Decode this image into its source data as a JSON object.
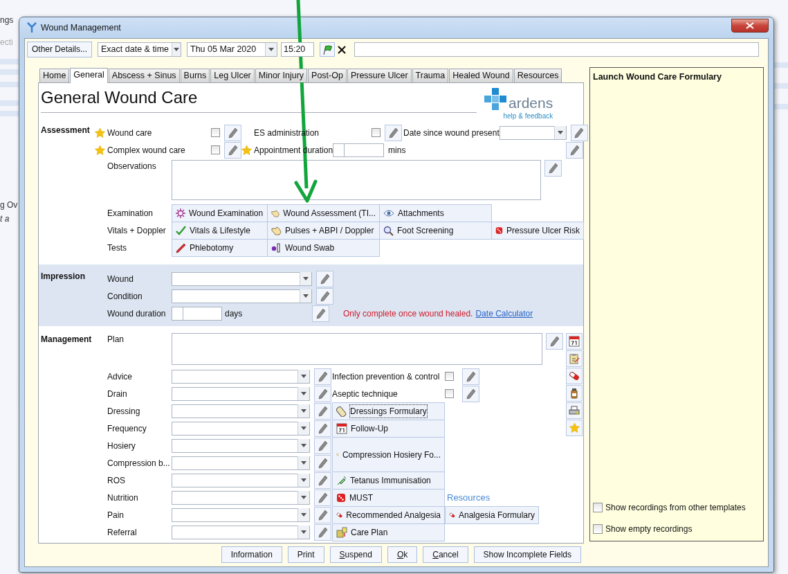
{
  "background": {
    "fragments": [
      "ngs",
      "ecti",
      "g Ov",
      "t a"
    ]
  },
  "window": {
    "title": "Wound Management"
  },
  "toolbar": {
    "details_button": "Other Details...",
    "date_mode": "Exact date & time",
    "date": "Thu 05 Mar 2020",
    "time": "15:20"
  },
  "tabs": [
    {
      "label": "Home",
      "selected": false
    },
    {
      "label": "General",
      "selected": true
    },
    {
      "label": "Abscess + Sinus",
      "selected": false
    },
    {
      "label": "Burns",
      "selected": false
    },
    {
      "label": "Leg Ulcer",
      "selected": false
    },
    {
      "label": "Minor Injury",
      "selected": false
    },
    {
      "label": "Post-Op",
      "selected": false
    },
    {
      "label": "Pressure Ulcer",
      "selected": false
    },
    {
      "label": "Trauma",
      "selected": false
    },
    {
      "label": "Healed Wound",
      "selected": false
    },
    {
      "label": "Resources",
      "selected": false
    }
  ],
  "form": {
    "title": "General Wound Care",
    "logo": "ardens",
    "logo_link": "help & feedback"
  },
  "assessment": {
    "heading": "Assessment",
    "fields": [
      {
        "kind": "checkbox",
        "label": "Wound care",
        "starred": true,
        "checked": false
      },
      {
        "kind": "checkbox",
        "label": "ES administration",
        "starred": false,
        "checked": false
      },
      {
        "kind": "dropdown",
        "label": "Date since wound present",
        "starred": false
      },
      {
        "kind": "checkbox",
        "label": "Complex wound care",
        "starred": true,
        "checked": false
      },
      {
        "kind": "number",
        "label": "Appointment duration",
        "starred": true,
        "unit": "mins"
      },
      {
        "kind": "pencil"
      }
    ],
    "observations": {
      "label": "Observations"
    },
    "link_groups": [
      {
        "label": "Examination",
        "links": [
          "Wound Examination",
          "Wound Assessment (TI...",
          "Attachments"
        ]
      },
      {
        "label": "Vitals + Doppler",
        "links": [
          "Vitals & Lifestyle",
          "Pulses + ABPI / Doppler",
          "Foot Screening",
          "Pressure Ulcer Risk"
        ]
      },
      {
        "label": "Tests",
        "links": [
          "Phlebotomy",
          "Wound Swab"
        ]
      }
    ]
  },
  "impression": {
    "heading": "Impression",
    "rows": [
      {
        "kind": "dropdown",
        "label": "Wound"
      },
      {
        "kind": "dropdown",
        "label": "Condition"
      },
      {
        "kind": "number",
        "label": "Wound duration",
        "unit": "days",
        "note": "Only complete once wound healed.",
        "link": "Date Calculator"
      }
    ]
  },
  "management": {
    "heading": "Management",
    "plan": {
      "label": "Plan"
    },
    "rows": [
      {
        "label": "Advice",
        "side": {
          "kind": "checkbox",
          "label": "Infection prevention & control",
          "checked": false
        }
      },
      {
        "label": "Drain",
        "side": {
          "kind": "checkbox",
          "label": "Aseptic technique",
          "checked": false
        }
      },
      {
        "label": "Dressing",
        "side": {
          "kind": "link",
          "label": "Dressings Formulary",
          "focused": true
        }
      },
      {
        "label": "Frequency",
        "side": {
          "kind": "link",
          "label": "Follow-Up",
          "focused": false
        }
      },
      {
        "label": "Hosiery",
        "side": {
          "kind": "link",
          "label": "Compression Hosiery Fo...",
          "focused": false,
          "tall": true
        }
      },
      {
        "label": "Compression b..."
      },
      {
        "label": "ROS",
        "side": {
          "kind": "link",
          "label": "Tetanus Immunisation",
          "focused": false
        }
      },
      {
        "label": "Nutrition",
        "side": {
          "kind": "link",
          "label": "MUST",
          "focused": false
        },
        "extra": {
          "kind": "heading",
          "label": "Resources"
        }
      },
      {
        "label": "Pain",
        "side": {
          "kind": "link",
          "label": "Recommended Analgesia",
          "focused": false
        },
        "extra": {
          "kind": "link",
          "label": "Analgesia Formulary"
        }
      },
      {
        "label": "Referral",
        "side": {
          "kind": "link",
          "label": "Care Plan",
          "focused": false
        }
      }
    ]
  },
  "footer_buttons": [
    {
      "label": "Information",
      "mnemonic": false
    },
    {
      "label": "Print",
      "mnemonic": false
    },
    {
      "label": "Suspend",
      "mnemonic": true
    },
    {
      "label": "Ok",
      "mnemonic": true
    },
    {
      "label": "Cancel",
      "mnemonic": true
    },
    {
      "label": "Show Incomplete Fields",
      "mnemonic": false
    }
  ],
  "side_panel": {
    "title": "Launch Wound Care Formulary",
    "options": [
      {
        "label": "Show recordings from other templates",
        "checked": false
      },
      {
        "label": "Show empty recordings",
        "checked": false
      }
    ]
  }
}
